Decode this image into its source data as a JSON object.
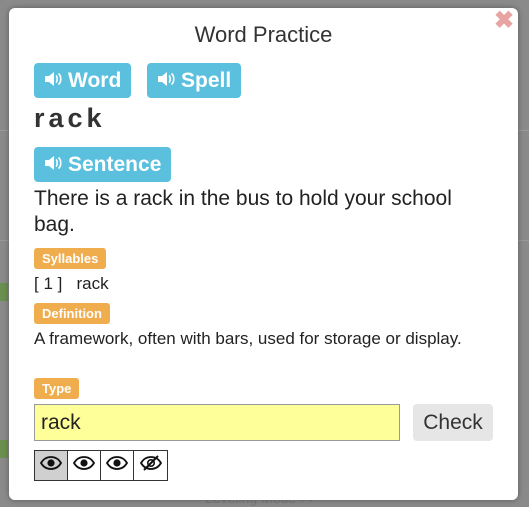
{
  "dialog": {
    "title": "Word Practice",
    "close_glyph": "✖",
    "buttons": {
      "word": "Word",
      "spell": "Spell",
      "sentence": "Sentence"
    },
    "word": "rack",
    "sentence_text": "There is a rack in the bus to hold your school bag.",
    "syllables_label": "Syllables",
    "syllables_text": "[ 1 ]   rack",
    "definition_label": "Definition",
    "definition_text": "A framework, often with bars, used for storage or display.",
    "type_label": "Type",
    "type_input_value": "rack",
    "check_label": "Check",
    "visibility_options": [
      {
        "icon": "eye-icon",
        "selected": true
      },
      {
        "icon": "eye-icon",
        "selected": false
      },
      {
        "icon": "eye-icon",
        "selected": false
      },
      {
        "icon": "eye-slash-icon",
        "selected": false
      }
    ]
  },
  "background": {
    "footer_text": "Leveling Mode >>"
  },
  "colors": {
    "audio_button": "#5bc0de",
    "tag": "#f0ad4e",
    "input_bg": "#ffff99",
    "close": "#e8a3a3"
  }
}
